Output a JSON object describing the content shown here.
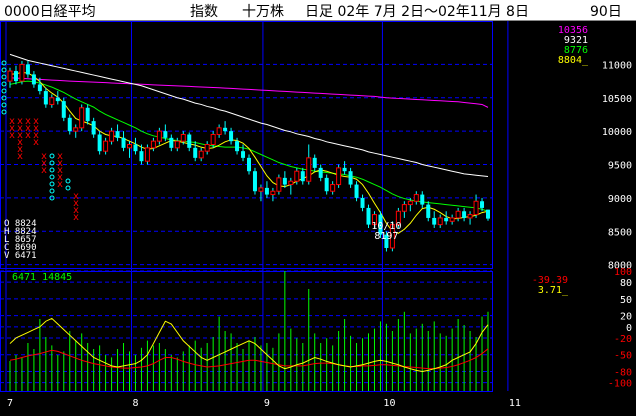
{
  "header": {
    "code_name": "0000日経平均",
    "kind": "指数",
    "unit": "十万株",
    "period": "日足 02年 7月 2日～02年11月 8日",
    "days": "90日"
  },
  "colors": {
    "background": "#000000",
    "grid": "#0000ff",
    "axis_text": "#ffffff",
    "candle_up": "#00ffff",
    "candle_down": "#00ffff",
    "ma_short": "#ffff00",
    "ma_mid": "#00ff00",
    "ma_long": "#ffffff",
    "ma_longest": "#ff00ff",
    "volume": "#00ff00",
    "osc_fast": "#ffff00",
    "osc_slow": "#ff0000",
    "pf_o": "#00ffff",
    "pf_x": "#ff0000"
  },
  "legend_values": [
    {
      "value": "10356",
      "color": "#ff00ff"
    },
    {
      "value": "9321",
      "color": "#ffffff"
    },
    {
      "value": "8776",
      "color": "#00ff00"
    },
    {
      "value": "8804_",
      "color": "#ffff00"
    }
  ],
  "ohlc_info": {
    "lines": [
      "O 8824",
      "H 8824",
      "L 8657",
      "C 8690",
      "V 6471"
    ],
    "volume_line": "6471 14845"
  },
  "osc_values": [
    {
      "value": "-39.39",
      "color": "#ff0000"
    },
    {
      "value": "3.71_",
      "color": "#ffff00"
    }
  ],
  "annotation": {
    "date": "10/10",
    "value": "8197"
  },
  "chart_data": {
    "type": "candlestick",
    "price_axis": {
      "ticks": [
        8000,
        8500,
        9000,
        9500,
        10000,
        10500,
        11000
      ],
      "ylim": [
        7950,
        11650
      ]
    },
    "osc_axis": {
      "ticks": [
        100,
        80,
        50,
        20,
        0,
        -20,
        -50,
        -80,
        -100
      ],
      "ylim": [
        -115,
        100
      ]
    },
    "x_month_labels": [
      {
        "label": "7",
        "index": 0
      },
      {
        "label": "8",
        "index": 21
      },
      {
        "label": "9",
        "index": 43
      },
      {
        "label": "10",
        "index": 63
      },
      {
        "label": "11",
        "index": 84
      }
    ],
    "candles": [
      [
        10750,
        10950,
        10650,
        10900
      ],
      [
        10900,
        10980,
        10700,
        10750
      ],
      [
        10750,
        11050,
        10700,
        11000
      ],
      [
        11000,
        11050,
        10800,
        10850
      ],
      [
        10850,
        10900,
        10650,
        10700
      ],
      [
        10700,
        10800,
        10550,
        10600
      ],
      [
        10600,
        10650,
        10350,
        10400
      ],
      [
        10400,
        10550,
        10350,
        10500
      ],
      [
        10500,
        10600,
        10400,
        10450
      ],
      [
        10450,
        10500,
        10150,
        10200
      ],
      [
        10200,
        10250,
        9950,
        10000
      ],
      [
        10000,
        10100,
        9900,
        10050
      ],
      [
        10050,
        10400,
        10000,
        10350
      ],
      [
        10350,
        10400,
        10100,
        10150
      ],
      [
        10150,
        10200,
        9900,
        9950
      ],
      [
        9950,
        10000,
        9650,
        9700
      ],
      [
        9700,
        9900,
        9650,
        9850
      ],
      [
        9850,
        10050,
        9800,
        10000
      ],
      [
        10000,
        10100,
        9850,
        9900
      ],
      [
        9900,
        10000,
        9700,
        9750
      ],
      [
        9750,
        9850,
        9600,
        9800
      ],
      [
        9800,
        9900,
        9650,
        9700
      ],
      [
        9700,
        9800,
        9500,
        9550
      ],
      [
        9550,
        9800,
        9500,
        9750
      ],
      [
        9750,
        9900,
        9700,
        9850
      ],
      [
        9850,
        10050,
        9800,
        10000
      ],
      [
        10000,
        10100,
        9850,
        9900
      ],
      [
        9900,
        9950,
        9700,
        9750
      ],
      [
        9750,
        9900,
        9700,
        9850
      ],
      [
        9850,
        10000,
        9800,
        9950
      ],
      [
        9950,
        9980,
        9700,
        9750
      ],
      [
        9750,
        9850,
        9550,
        9600
      ],
      [
        9600,
        9750,
        9550,
        9700
      ],
      [
        9700,
        9850,
        9650,
        9800
      ],
      [
        9800,
        10000,
        9750,
        9950
      ],
      [
        9950,
        10100,
        9900,
        10050
      ],
      [
        10050,
        10150,
        9950,
        10000
      ],
      [
        10000,
        10050,
        9800,
        9850
      ],
      [
        9850,
        9900,
        9650,
        9700
      ],
      [
        9700,
        9800,
        9550,
        9600
      ],
      [
        9600,
        9650,
        9350,
        9400
      ],
      [
        9400,
        9450,
        9050,
        9100
      ],
      [
        9100,
        9200,
        8950,
        9150
      ],
      [
        9150,
        9250,
        9000,
        9050
      ],
      [
        9050,
        9150,
        8950,
        9100
      ],
      [
        9100,
        9350,
        9050,
        9300
      ],
      [
        9300,
        9400,
        9150,
        9200
      ],
      [
        9200,
        9300,
        9050,
        9250
      ],
      [
        9250,
        9450,
        9200,
        9400
      ],
      [
        9400,
        9450,
        9200,
        9250
      ],
      [
        9250,
        9800,
        9200,
        9600
      ],
      [
        9600,
        9650,
        9400,
        9450
      ],
      [
        9450,
        9500,
        9250,
        9300
      ],
      [
        9300,
        9350,
        9050,
        9100
      ],
      [
        9100,
        9250,
        9050,
        9200
      ],
      [
        9200,
        9500,
        9150,
        9450
      ],
      [
        9450,
        9550,
        9350,
        9400
      ],
      [
        9400,
        9450,
        9150,
        9200
      ],
      [
        9200,
        9250,
        8950,
        9000
      ],
      [
        9000,
        9050,
        8800,
        8850
      ],
      [
        8850,
        8900,
        8550,
        8600
      ],
      [
        8600,
        8800,
        8550,
        8750
      ],
      [
        8750,
        8800,
        8400,
        8450
      ],
      [
        8450,
        8500,
        8197,
        8250
      ],
      [
        8250,
        8650,
        8200,
        8600
      ],
      [
        8600,
        8850,
        8550,
        8800
      ],
      [
        8800,
        8950,
        8700,
        8900
      ],
      [
        8900,
        9000,
        8800,
        8950
      ],
      [
        8950,
        9100,
        8900,
        9050
      ],
      [
        9050,
        9100,
        8850,
        8900
      ],
      [
        8900,
        8950,
        8650,
        8700
      ],
      [
        8700,
        8800,
        8550,
        8600
      ],
      [
        8600,
        8750,
        8550,
        8700
      ],
      [
        8700,
        8800,
        8600,
        8650
      ],
      [
        8650,
        8750,
        8600,
        8700
      ],
      [
        8700,
        8850,
        8650,
        8800
      ],
      [
        8800,
        8850,
        8650,
        8700
      ],
      [
        8700,
        8800,
        8600,
        8750
      ],
      [
        8750,
        9050,
        8700,
        8950
      ],
      [
        8950,
        9000,
        8800,
        8850
      ],
      [
        8824,
        8824,
        8657,
        8690
      ]
    ],
    "ma_short": [
      10850,
      10860,
      10880,
      10870,
      10820,
      10740,
      10640,
      10570,
      10510,
      10420,
      10300,
      10190,
      10150,
      10120,
      10080,
      10000,
      9950,
      9930,
      9920,
      9890,
      9850,
      9810,
      9760,
      9730,
      9740,
      9780,
      9820,
      9860,
      9850,
      9830,
      9810,
      9790,
      9760,
      9740,
      9750,
      9790,
      9840,
      9870,
      9860,
      9820,
      9740,
      9610,
      9470,
      9330,
      9230,
      9180,
      9170,
      9200,
      9250,
      9290,
      9330,
      9390,
      9420,
      9400,
      9370,
      9340,
      9320,
      9310,
      9280,
      9200,
      9070,
      8920,
      8780,
      8620,
      8500,
      8470,
      8530,
      8620,
      8740,
      8840,
      8860,
      8830,
      8780,
      8720,
      8690,
      8690,
      8710,
      8720,
      8740,
      8780,
      8800
    ],
    "ma_mid": [
      10700,
      10720,
      10740,
      10750,
      10740,
      10720,
      10690,
      10660,
      10620,
      10580,
      10530,
      10480,
      10440,
      10400,
      10360,
      10300,
      10250,
      10210,
      10170,
      10130,
      10090,
      10050,
      10000,
      9960,
      9930,
      9910,
      9890,
      9870,
      9860,
      9850,
      9840,
      9830,
      9810,
      9790,
      9780,
      9770,
      9760,
      9760,
      9760,
      9750,
      9730,
      9690,
      9650,
      9610,
      9570,
      9530,
      9500,
      9470,
      9450,
      9430,
      9420,
      9400,
      9390,
      9380,
      9370,
      9360,
      9350,
      9330,
      9310,
      9280,
      9240,
      9200,
      9160,
      9110,
      9060,
      9020,
      8990,
      8970,
      8950,
      8940,
      8930,
      8920,
      8910,
      8900,
      8890,
      8880,
      8870,
      8860,
      8850,
      8830,
      8800
    ],
    "ma_long": [
      11150,
      11120,
      11090,
      11060,
      11040,
      11020,
      11000,
      10980,
      10960,
      10940,
      10920,
      10900,
      10880,
      10860,
      10840,
      10820,
      10800,
      10780,
      10760,
      10740,
      10720,
      10700,
      10680,
      10650,
      10620,
      10590,
      10560,
      10530,
      10500,
      10480,
      10450,
      10420,
      10400,
      10370,
      10350,
      10320,
      10300,
      10270,
      10240,
      10210,
      10180,
      10150,
      10120,
      10100,
      10070,
      10040,
      10010,
      9990,
      9960,
      9940,
      9920,
      9890,
      9870,
      9840,
      9820,
      9800,
      9780,
      9760,
      9740,
      9720,
      9690,
      9670,
      9650,
      9630,
      9610,
      9590,
      9570,
      9550,
      9530,
      9500,
      9480,
      9460,
      9440,
      9420,
      9400,
      9380,
      9360,
      9350,
      9340,
      9330,
      9320
    ],
    "ma_longest": [
      10800,
      10795,
      10790,
      10785,
      10780,
      10775,
      10770,
      10765,
      10760,
      10755,
      10750,
      10746,
      10742,
      10738,
      10734,
      10730,
      10726,
      10722,
      10718,
      10714,
      10710,
      10706,
      10702,
      10698,
      10694,
      10690,
      10686,
      10682,
      10678,
      10674,
      10670,
      10666,
      10662,
      10658,
      10654,
      10650,
      10645,
      10640,
      10635,
      10630,
      10625,
      10620,
      10615,
      10610,
      10605,
      10600,
      10595,
      10590,
      10585,
      10580,
      10575,
      10570,
      10565,
      10560,
      10555,
      10550,
      10545,
      10540,
      10535,
      10530,
      10525,
      10520,
      10510,
      10500,
      10495,
      10490,
      10485,
      10480,
      10475,
      10470,
      10465,
      10460,
      10455,
      10450,
      10445,
      10440,
      10430,
      10420,
      10410,
      10400,
      10356
    ],
    "volume_pct": [
      25,
      30,
      28,
      40,
      35,
      60,
      45,
      38,
      30,
      33,
      50,
      42,
      48,
      40,
      35,
      38,
      30,
      28,
      35,
      40,
      33,
      30,
      36,
      42,
      38,
      40,
      35,
      30,
      28,
      33,
      38,
      42,
      36,
      40,
      45,
      62,
      50,
      48,
      40,
      35,
      42,
      45,
      38,
      40,
      36,
      48,
      100,
      52,
      44,
      40,
      85,
      48,
      40,
      44,
      38,
      50,
      60,
      46,
      40,
      44,
      48,
      52,
      58,
      56,
      50,
      60,
      66,
      48,
      52,
      56,
      50,
      58,
      48,
      46,
      52,
      60,
      55,
      50,
      45,
      62,
      66
    ],
    "osc_fast": [
      -30,
      -20,
      -15,
      -10,
      -5,
      0,
      10,
      15,
      5,
      -5,
      -15,
      -25,
      -35,
      -45,
      -55,
      -60,
      -65,
      -70,
      -72,
      -70,
      -68,
      -66,
      -60,
      -50,
      -30,
      -10,
      10,
      5,
      -10,
      -25,
      -35,
      -45,
      -55,
      -60,
      -55,
      -50,
      -45,
      -40,
      -35,
      -30,
      -25,
      -30,
      -40,
      -50,
      -60,
      -70,
      -75,
      -72,
      -68,
      -65,
      -60,
      -55,
      -58,
      -62,
      -65,
      -68,
      -70,
      -72,
      -70,
      -68,
      -65,
      -62,
      -60,
      -62,
      -65,
      -68,
      -72,
      -75,
      -78,
      -80,
      -78,
      -75,
      -72,
      -68,
      -60,
      -55,
      -50,
      -45,
      -30,
      -10,
      3.71
    ],
    "osc_slow": [
      -60,
      -58,
      -55,
      -52,
      -50,
      -48,
      -45,
      -42,
      -44,
      -48,
      -52,
      -56,
      -60,
      -63,
      -66,
      -68,
      -70,
      -72,
      -73,
      -74,
      -74,
      -73,
      -72,
      -70,
      -66,
      -60,
      -55,
      -55,
      -58,
      -62,
      -65,
      -68,
      -70,
      -72,
      -71,
      -70,
      -68,
      -66,
      -64,
      -62,
      -60,
      -60,
      -62,
      -64,
      -66,
      -68,
      -70,
      -70,
      -70,
      -70,
      -68,
      -66,
      -65,
      -65,
      -66,
      -68,
      -70,
      -71,
      -71,
      -70,
      -70,
      -69,
      -68,
      -68,
      -69,
      -70,
      -71,
      -72,
      -73,
      -74,
      -75,
      -75,
      -74,
      -73,
      -71,
      -68,
      -64,
      -60,
      -55,
      -48,
      -39.39
    ]
  }
}
